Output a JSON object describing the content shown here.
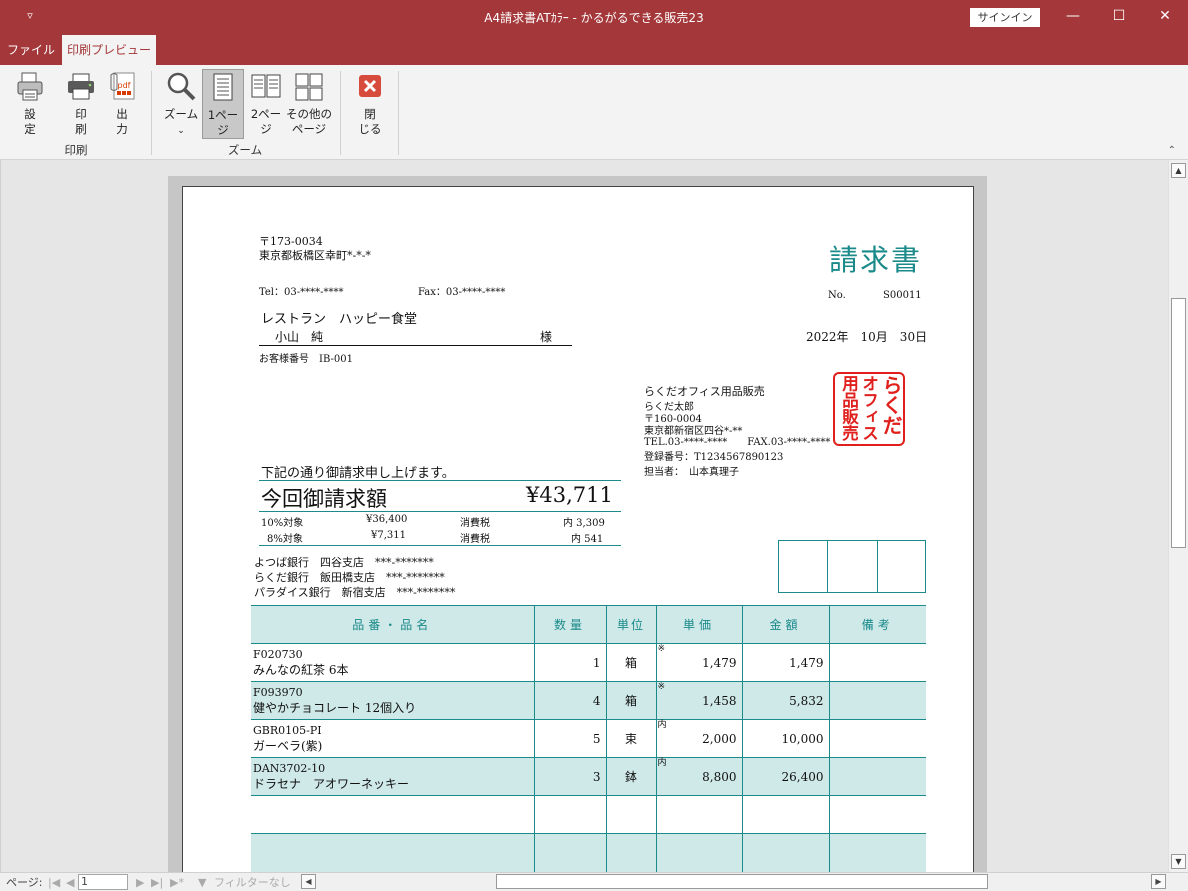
{
  "window": {
    "qat_icon": "quick-access-menu-icon",
    "title": "A4請求書ATｶﾗｰ  -  かるがるできる販売23",
    "signin": "サインイン"
  },
  "tabs": {
    "file": "ファイル",
    "print_preview": "印刷プレビュー"
  },
  "ribbon": {
    "setup": "設\n定",
    "print": "印\n刷",
    "output": "出\n力",
    "group_print": "印刷",
    "zoom": "ズーム",
    "one_page": "1ペー\nジ",
    "two_pages": "2ペー\nジ",
    "other_pages": "その他の\nページ",
    "group_zoom": "ズーム",
    "close": "閉\nじる",
    "pdf_badge": "pdf"
  },
  "statusbar": {
    "page_label": "ページ:",
    "page_value": "1",
    "filter": "フィルターなし"
  },
  "invoice": {
    "title": "請求書",
    "postal": "〒173-0034",
    "address": "東京都板橋区幸町*-*-*",
    "tel": "Tel：03-****-****",
    "fax": "Fax：03-****-****",
    "no_label": "No.",
    "no_value": "S00011",
    "customer_company": "レストラン　ハッピー食堂",
    "customer_person": "小山　純",
    "honorific": "様",
    "date": "2022年　10月　30日",
    "customer_number": "お客様番号　IB-001",
    "sender": {
      "company": "らくだオフィス用品販売",
      "person": "らくだ太郎",
      "postal": "〒160-0004",
      "address": "東京都新宿区四谷*-**",
      "telfax": "TEL.03-****-****　　FAX.03-****-****",
      "registration": "登録番号：T1234567890123",
      "staff": "担当者：　山本真理子"
    },
    "stamp": {
      "col1": "らくだ",
      "col2": "オフィス",
      "col3": "用品販売"
    },
    "intro": "下記の通り御請求申し上げます。",
    "total_label": "今回御請求額",
    "total_value": "¥43,711",
    "tax10_label": "10%対象",
    "tax10_amount": "¥36,400",
    "tax10_tax_label": "消費税",
    "tax10_tax": "内 3,309",
    "tax8_label": "8%対象",
    "tax8_amount": "¥7,311",
    "tax8_tax_label": "消費税",
    "tax8_tax": "内 541",
    "banks": [
      "よつば銀行　四谷支店　***-*******",
      "らくだ銀行　飯田橋支店　***-*******",
      "パラダイス銀行　新宿支店　***-*******"
    ],
    "columns": [
      "品番・品名",
      "数量",
      "単位",
      "単価",
      "金額",
      "備考"
    ],
    "items": [
      {
        "code": "F020730",
        "name": "みんなの紅茶 6本",
        "qty": "1",
        "unit": "箱",
        "mark": "※",
        "price": "1,479",
        "amount": "1,479",
        "note": ""
      },
      {
        "code": "F093970",
        "name": "健やかチョコレート 12個入り",
        "qty": "4",
        "unit": "箱",
        "mark": "※",
        "price": "1,458",
        "amount": "5,832",
        "note": ""
      },
      {
        "code": "GBR0105-PI",
        "name": "ガーベラ(紫)",
        "qty": "5",
        "unit": "束",
        "mark": "内",
        "price": "2,000",
        "amount": "10,000",
        "note": ""
      },
      {
        "code": "DAN3702-10",
        "name": "ドラセナ　アオワーネッキー",
        "qty": "3",
        "unit": "鉢",
        "mark": "内",
        "price": "8,800",
        "amount": "26,400",
        "note": ""
      }
    ]
  }
}
